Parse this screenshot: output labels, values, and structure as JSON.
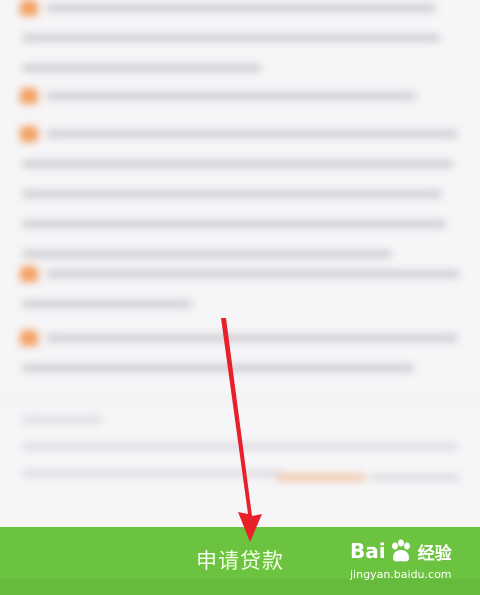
{
  "bottom_bar": {
    "apply_button_label": "申请贷款",
    "bar_color": "#6cc33f"
  },
  "watermark": {
    "brand_text": "Bai",
    "brand_suffix": "经验",
    "url": "jingyan.baidu.com",
    "paw_icon": "baidu-paw-icon"
  },
  "annotation": {
    "arrow_color": "#e8202a",
    "arrow_icon": "red-arrow-icon"
  },
  "colors": {
    "background": "#f6f5f7",
    "bullet": "#f2a061",
    "blurred_text": "#cfced2"
  }
}
